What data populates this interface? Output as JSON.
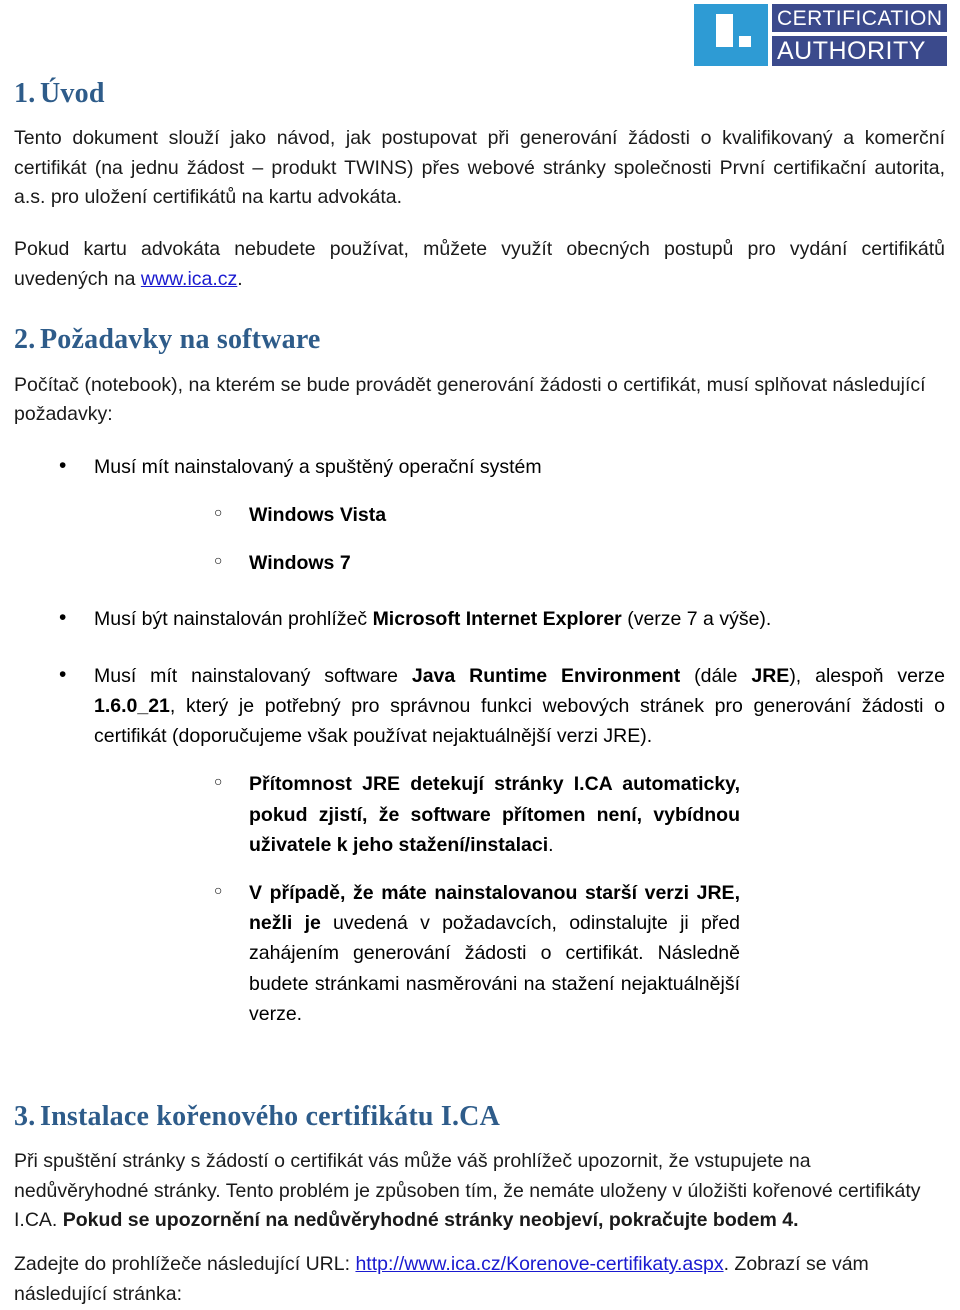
{
  "logo": {
    "line1": "CERTIFICATION",
    "line2": "AUTHORITY",
    "mark_color": "#2e9bd4",
    "band_color": "#3b4a8c"
  },
  "heading_color": "#2e5c8a",
  "link_color": "#1a1ad0",
  "sections": {
    "s1": {
      "number": "1.",
      "title": "Úvod",
      "p1_a": "Tento dokument slouží jako návod, jak postupovat při generování žádosti o kvalifikovaný a komerční certifikát (na jednu žádost – produkt TWINS) přes webové stránky společnosti První certifikační autorita, a.s. pro uložení certifikátů na kartu advokáta.",
      "p2_a": "Pokud kartu advokáta nebudete používat, můžete využít obecných postupů pro vydání certifikátů uvedených na ",
      "p2_link": "www.ica.cz",
      "p2_b": "."
    },
    "s2": {
      "number": "2.",
      "title": "Požadavky na software",
      "intro": "Počítač (notebook), na kterém se bude provádět generování žádosti o certifikát, musí splňovat následující požadavky:",
      "b1": "Musí mít nainstalovaný a spuštěný operační systém",
      "b1_sub1": "Windows Vista",
      "b1_sub2": "Windows 7",
      "b2_a": "Musí být nainstalován prohlížeč ",
      "b2_bold": "Microsoft Internet Explorer",
      "b2_b": " (verze 7 a výše).",
      "b3_a": "Musí mít nainstalovaný software ",
      "b3_bold1": "Java Runtime Environment",
      "b3_b": " (dále ",
      "b3_bold2": "JRE",
      "b3_c": "), alespoň verze ",
      "b3_bold3": "1.6.0_21",
      "b3_d": ", který je potřebný pro správnou funkci webových stránek pro generování žádosti o certifikát (doporučujeme však používat nejaktuálnější verzi JRE).",
      "b3_sub1_bold": "Přítomnost JRE detekují stránky I.CA automaticky, pokud zjistí, že software přítomen není, vybídnou uživatele k jeho stažení/instalaci",
      "b3_sub1_tail": ".",
      "b3_sub2_bold": "V případě, že máte nainstalovanou starší verzi JRE, nežli je",
      "b3_sub2_rest": " uvedená v požadavcích, odinstalujte ji před zahájením generování žádosti o certifikát. Následně budete stránkami nasměrováni na stažení nejaktuálnější verze."
    },
    "s3": {
      "number": "3.",
      "title": "Instalace kořenového certifikátu I.CA",
      "p1_a": "Při spuštění stránky s žádostí o certifikát vás může váš prohlížeč upozornit, že vstupujete na nedůvěryhodné stránky. Tento problém je způsoben tím, že nemáte uloženy v úložišti kořenové certifikáty I.CA. ",
      "p1_bold": "Pokud se upozornění na nedůvěryhodné stránky neobjeví, pokračujte bodem 4.",
      "p2_a": "Zadejte do prohlížeče následující URL: ",
      "p2_link": "http://www.ica.cz/Korenove-certifikaty.aspx",
      "p2_b": ". Zobrazí se vám následující stránka:"
    }
  }
}
